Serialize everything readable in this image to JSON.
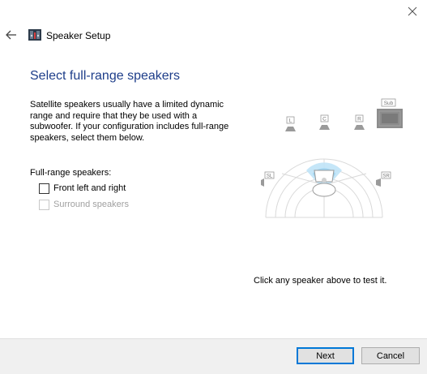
{
  "window": {
    "title": "Speaker Setup",
    "close_icon": "close-icon",
    "back_icon": "back-arrow-icon",
    "app_icon": "speaker-setup-icon"
  },
  "main": {
    "heading": "Select full-range speakers",
    "description": "Satellite speakers usually have a limited dynamic range and require that they be used with a subwoofer.  If your configuration includes full-range speakers, select them below.",
    "group_label": "Full-range speakers:",
    "options": [
      {
        "label": "Front left and right",
        "checked": false,
        "enabled": true
      },
      {
        "label": "Surround speakers",
        "checked": false,
        "enabled": false
      }
    ],
    "hint": "Click any speaker above to test it."
  },
  "diagram": {
    "speaker_labels": {
      "left": "L",
      "center": "C",
      "right": "R",
      "subwoofer": "Sub",
      "surround_left": "SL",
      "surround_right": "SR"
    },
    "colors": {
      "arc": "#d9d9d9",
      "highlight": "#bfe3f7",
      "speaker": "#9a9a9a",
      "subwoofer": "#8c8c8c"
    }
  },
  "footer": {
    "next_label": "Next",
    "cancel_label": "Cancel"
  },
  "colors": {
    "heading": "#1e3e8a",
    "accent": "#0078d7",
    "footer_bg": "#f0f0f0"
  }
}
